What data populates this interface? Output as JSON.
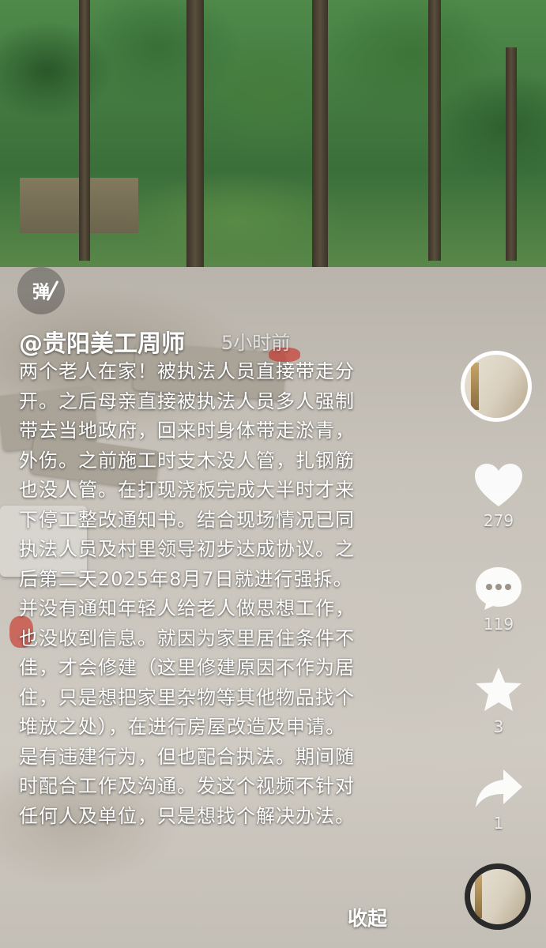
{
  "author": {
    "name": "@贵阳美工周师",
    "time": "5小时前"
  },
  "danmu": {
    "label": "弹"
  },
  "caption": {
    "lines": [
      "两个老人在家！被执法人员直接带走分",
      "开。之后母亲直接被执法人员多人强制",
      "带去当地政府，回来时身体带走淤青，",
      "外伤。之前施工时支木没人管，扎钢筋",
      "也没人管。在打现浇板完成大半时才来",
      "下停工整改通知书。结合现场情况已同",
      "执法人员及村里领导初步达成协议。之",
      "后第二天2025年8月7日就进行强拆。",
      "并没有通知年轻人给老人做思想工作，",
      "也没收到信息。就因为家里居住条件不",
      "佳，才会修建（这里修建原因不作为居",
      "住，只是想把家里杂物等其他物品找个",
      "堆放之处），在进行房屋改造及申请。",
      "是有违建行为，但也配合执法。期间随",
      "时配合工作及沟通。发这个视频不针对",
      "任何人及单位，只是想找个解决办法。"
    ],
    "collapse_label": "收起"
  },
  "actions": {
    "like_count": "279",
    "comment_count": "119",
    "favorite_count": "3",
    "share_count": "1"
  },
  "icons": {
    "like": "heart-icon",
    "comment": "comment-bubble-icon",
    "favorite": "star-icon",
    "share": "share-arrow-icon"
  }
}
